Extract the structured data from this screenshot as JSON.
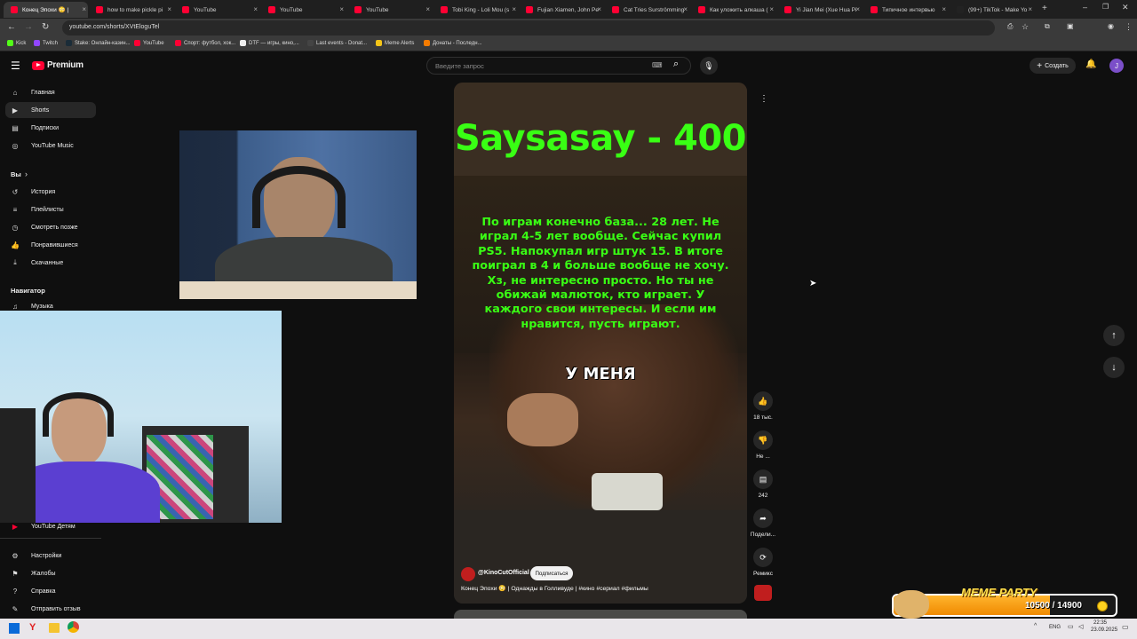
{
  "tabs": [
    {
      "title": "Конец Эпохи 😳 |",
      "color": "#ff0033",
      "active": true
    },
    {
      "title": "how to make pickle pi",
      "color": "#ff0033"
    },
    {
      "title": "YouTube",
      "color": "#ff0033"
    },
    {
      "title": "YouTube",
      "color": "#ff0033"
    },
    {
      "title": "YouTube",
      "color": "#ff0033"
    },
    {
      "title": "Tobi King - Loli Mou (s",
      "color": "#ff0033"
    },
    {
      "title": "Fujian Xiamen, John Pe",
      "color": "#ff0033"
    },
    {
      "title": "Cat Tries Surströmming",
      "color": "#ff0033"
    },
    {
      "title": "Как уложить алкаша (",
      "color": "#ff0033"
    },
    {
      "title": "Yi Jian Mei (Xue Hua Pi",
      "color": "#ff0033"
    },
    {
      "title": "Типичное интервью",
      "color": "#ff0033"
    },
    {
      "title": "(99+) TikTok - Make Yo",
      "color": "#222"
    }
  ],
  "url": "youtube.com/shorts/XVtEloguTel",
  "bookmarks": [
    {
      "label": "Kick",
      "color": "#53fc18"
    },
    {
      "label": "Twitch",
      "color": "#9146ff"
    },
    {
      "label": "Stake: Онлайн-казин...",
      "color": "#1a2c38"
    },
    {
      "label": "YouTube",
      "color": "#ff0033"
    },
    {
      "label": "Спорт: футбол, хок...",
      "color": "#ff0033"
    },
    {
      "label": "DTF — игры, кино,...",
      "color": "#eee"
    },
    {
      "label": "Last events - Donat...",
      "color": "#444"
    },
    {
      "label": "Meme Alerts",
      "color": "#f5c518"
    },
    {
      "label": "Донаты - Последн...",
      "color": "#f57c00"
    }
  ],
  "header": {
    "logo_text": "Premium",
    "search_placeholder": "Введите запрос",
    "create_label": "Создать",
    "avatar_letter": "J"
  },
  "sidebar": {
    "main": [
      {
        "icon": "⌂",
        "label": "Главная"
      },
      {
        "icon": "▶",
        "label": "Shorts",
        "active": true
      },
      {
        "icon": "▤",
        "label": "Подписки"
      },
      {
        "icon": "◎",
        "label": "YouTube Music"
      }
    ],
    "you_label": "Вы",
    "you_items": [
      {
        "icon": "↺",
        "label": "История"
      },
      {
        "icon": "≡",
        "label": "Плейлисты"
      },
      {
        "icon": "◷",
        "label": "Смотреть позже"
      },
      {
        "icon": "👍",
        "label": "Понравившиеся"
      },
      {
        "icon": "⤓",
        "label": "Скачанные"
      }
    ],
    "navigator_label": "Навигатор",
    "nav_items": [
      {
        "icon": "♫",
        "label": "Музыка"
      }
    ],
    "kids_label": "YouTube Детям",
    "bottom": [
      {
        "icon": "⚙",
        "label": "Настройки"
      },
      {
        "icon": "⚑",
        "label": "Жалобы"
      },
      {
        "icon": "?",
        "label": "Справка"
      },
      {
        "icon": "✎",
        "label": "Отправить отзыв"
      }
    ]
  },
  "short": {
    "title_overlay": "Saysasay  - 400",
    "message": "По играм конечно база... 28 лет. Не играл 4-5 лет вообще. Сейчас купил PS5. Напокупал игр штук 15. В итоге поиграл в 4 и больше вообще не хочу. Хз, не интересно просто. Но ты не обижай малюток, кто играет. У каждого свои интересы. И если им нравится, пусть играют.",
    "caption": "У МЕНЯ",
    "channel": "@KinoCutOfficial",
    "subscribe_label": "Подписаться",
    "description": "Конец Эпохи 😳 | Однажды в Голливуде | #кино #сериал #фильмы",
    "likes": "18 тыс.",
    "dislike_label": "Не ...",
    "comments": "242",
    "share_label": "Подели...",
    "remix_label": "Ремикс"
  },
  "donation": {
    "label": "MEME PARTY",
    "progress_text": "10500 / 14900",
    "current": 10500,
    "goal": 14900
  },
  "taskbar": {
    "lang": "ENG",
    "time": "22:35",
    "date": "23.09.2025"
  },
  "colors": {
    "accent": "#ff0033",
    "overlay_green": "#39ff14"
  }
}
